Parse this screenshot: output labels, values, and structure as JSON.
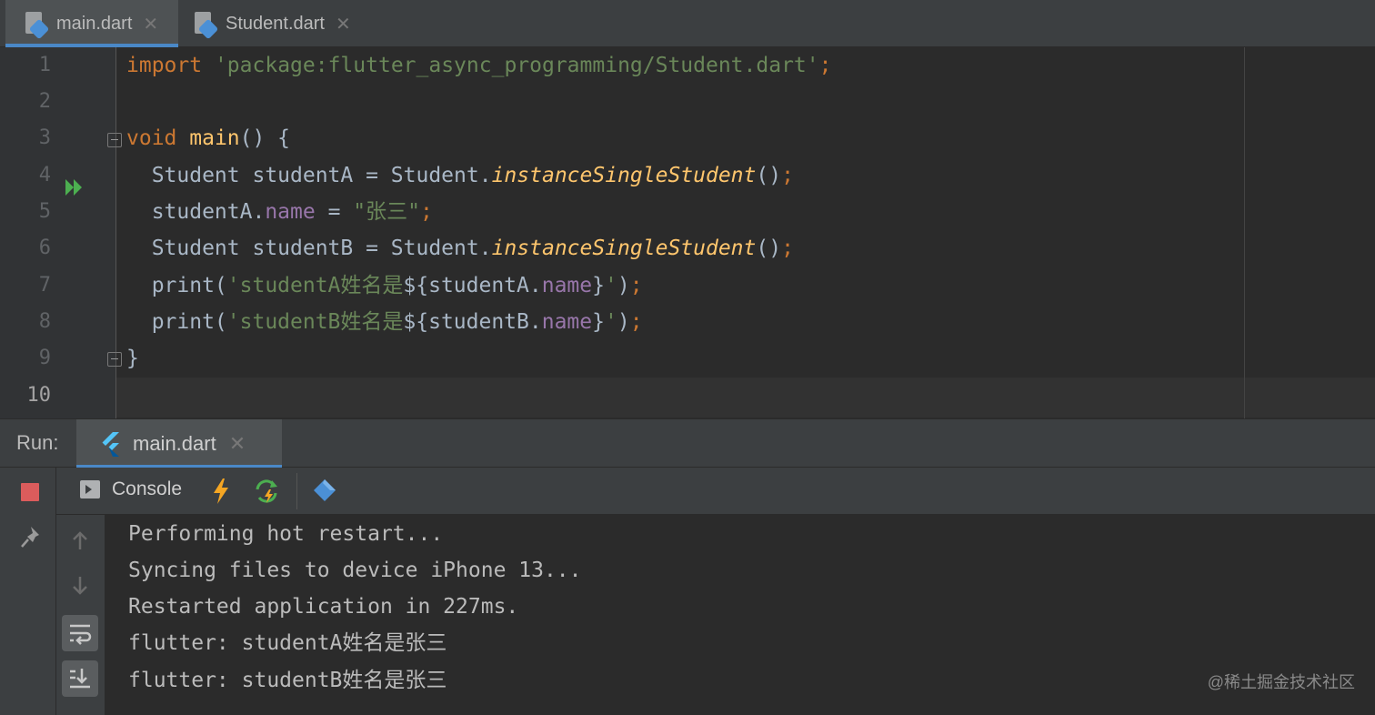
{
  "editor_tabs": [
    {
      "label": "main.dart",
      "active": true
    },
    {
      "label": "Student.dart",
      "active": false
    }
  ],
  "tab_close_glyph": "✕",
  "editor": {
    "line_numbers": [
      "1",
      "2",
      "3",
      "4",
      "5",
      "6",
      "7",
      "8",
      "9",
      "10"
    ],
    "code": {
      "l1_kw": "import",
      "l1_str": "'package:flutter_async_programming/Student.dart'",
      "l1_end": ";",
      "l3_kw": "void",
      "l3_fn": "main",
      "l3_rest": "() {",
      "l4_a": "  Student studentA = Student.",
      "l4_it": "instanceSingleStudent",
      "l4_b": "()",
      "l4_end": ";",
      "l5_a": "  studentA.",
      "l5_prop": "name",
      "l5_b": " = ",
      "l5_str": "\"张三\"",
      "l5_end": ";",
      "l6_a": "  Student studentB = Student.",
      "l6_it": "instanceSingleStudent",
      "l6_b": "()",
      "l6_end": ";",
      "l7_a": "  print(",
      "l7_str": "'studentA姓名是",
      "l7_b": "${studentA.",
      "l7_prop": "name",
      "l7_c": "}",
      "l7_str2": "'",
      "l7_d": ")",
      "l7_end": ";",
      "l8_a": "  print(",
      "l8_str": "'studentB姓名是",
      "l8_b": "${studentB.",
      "l8_prop": "name",
      "l8_c": "}",
      "l8_str2": "'",
      "l8_d": ")",
      "l8_end": ";",
      "l9": "}"
    }
  },
  "run_panel": {
    "label": "Run:",
    "tab_label": "main.dart",
    "console_label": "Console",
    "output": [
      "Performing hot restart...",
      "Syncing files to device iPhone 13...",
      "Restarted application in 227ms.",
      "flutter: studentA姓名是张三",
      "flutter: studentB姓名是张三"
    ],
    "watermark": "@稀土掘金技术社区"
  },
  "colors": {
    "keyword": "#cc7832",
    "string": "#6a8759",
    "function": "#ffc66d",
    "property": "#9876aa",
    "accent": "#4a88c7",
    "stop": "#db5c5c"
  }
}
